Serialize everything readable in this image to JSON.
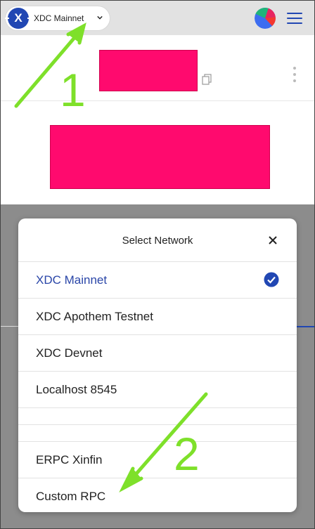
{
  "header": {
    "network_pill": {
      "logo_letter": "X",
      "name": "XDC Mainnet"
    }
  },
  "modal": {
    "title": "Select Network",
    "networks": [
      {
        "label": "XDC Mainnet",
        "selected": true
      },
      {
        "label": "XDC Apothem Testnet",
        "selected": false
      },
      {
        "label": "XDC Devnet",
        "selected": false
      },
      {
        "label": "Localhost 8545",
        "selected": false
      },
      {
        "label": "",
        "selected": false
      },
      {
        "label": "",
        "selected": false
      },
      {
        "label": "ERPC Xinfin",
        "selected": false
      },
      {
        "label": "Custom RPC",
        "selected": false
      }
    ]
  },
  "annotations": {
    "step1": "1",
    "step2": "2"
  },
  "colors": {
    "accent": "#2147b3",
    "redaction": "#ff0a6e",
    "annotation": "#7ee02a",
    "selected_text": "#2a46a8"
  },
  "icons": {
    "network_chevron": "chevron-down-icon",
    "copy": "copy-icon",
    "menu": "hamburger-icon",
    "close": "close-icon",
    "check": "check-circle-icon",
    "kebab": "kebab-menu-icon"
  }
}
